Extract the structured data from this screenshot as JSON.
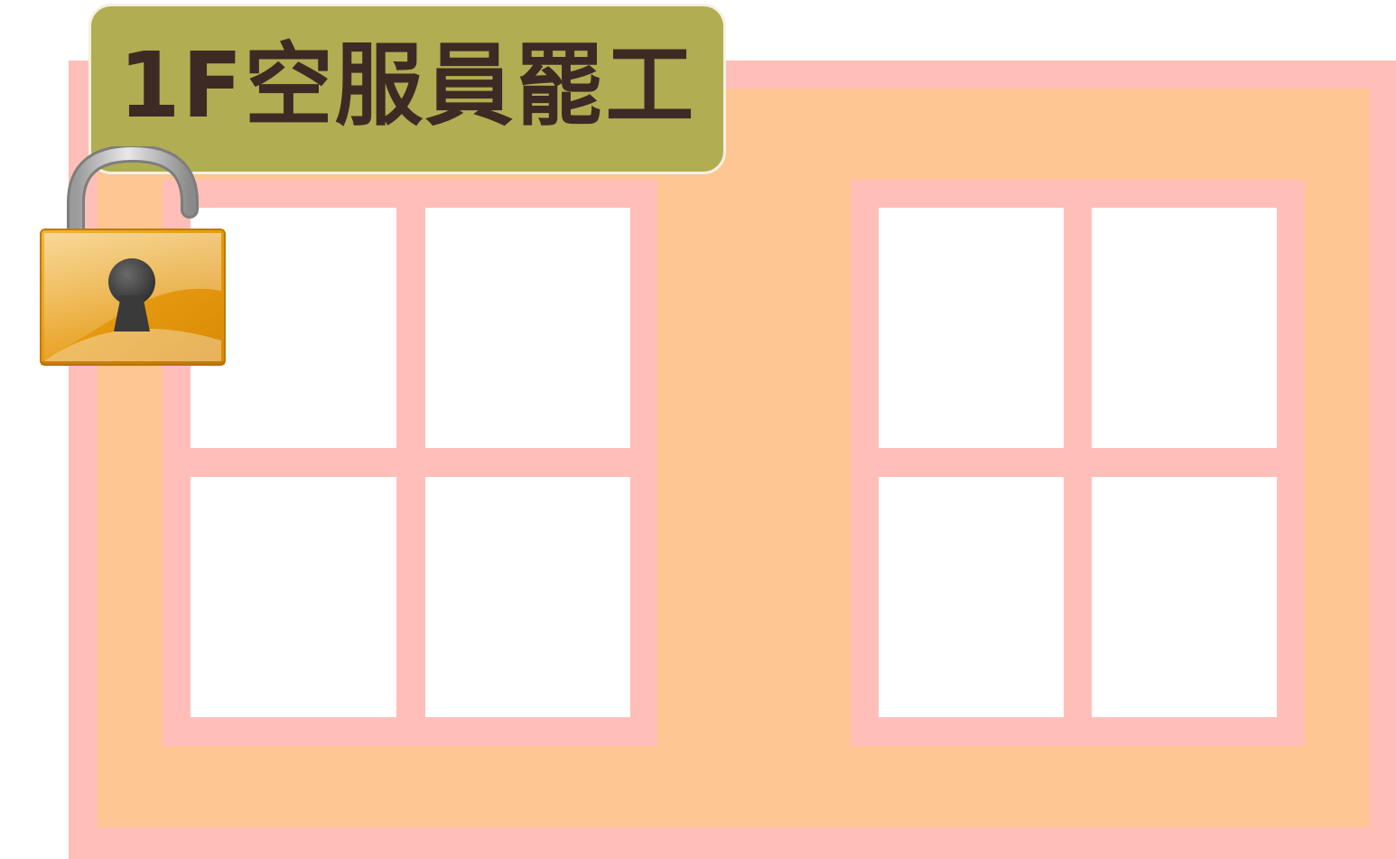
{
  "title": "1F空服員罷工",
  "icons": {
    "lock": "padlock-icon"
  },
  "colors": {
    "wall_border": "#ffbfb8",
    "wall_fill": "#fec692",
    "title_plate": "#b1ad52",
    "title_text": "#3e2a24",
    "lock_body": "#e59a0c"
  }
}
